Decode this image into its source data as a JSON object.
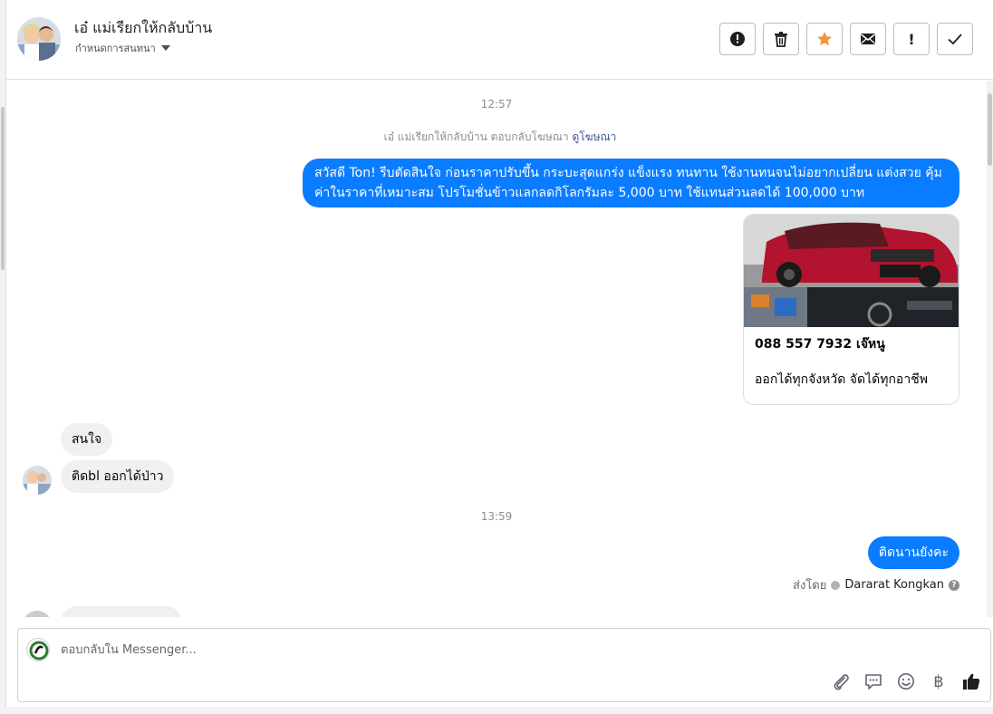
{
  "header": {
    "title": "เอ๋ แม่เรียกให้กลับบ้าน",
    "assign_label": "กำหนดการสนทนา"
  },
  "toolbar": {
    "buttons": [
      {
        "icon": "alert-circle-icon"
      },
      {
        "icon": "trash-icon"
      },
      {
        "icon": "star-icon",
        "color": "#f7923a"
      },
      {
        "icon": "envelope-icon"
      },
      {
        "icon": "exclamation-icon",
        "glyph": "!"
      },
      {
        "icon": "check-icon"
      }
    ]
  },
  "conversation": {
    "timestamp_1": "12:57",
    "reply_note": "เอ๋ แม่เรียกให้กลับบ้าน ตอบกลับโฆษณา",
    "reply_link": "ดูโฆษณา",
    "outgoing_1": "สวัสดี Ton! รีบตัดสินใจ ก่อนราคาปรับขึ้น กระบะสุดแกร่ง แข็งแรง ทนทาน ใช้งานทนจนไม่อยากเปลี่ยน แต่งสวย คุ้มค่าในราคาที่เหมาะสม โปรโมชั่นข้าวแลกลดกิโลกรัมละ 5,000 บาท ใช้แทนส่วนลดได้ 100,000 บาท",
    "card": {
      "title": "088 557 7932 เจ๊หนู",
      "description": "ออกได้ทุกจังหวัด จัดได้ทุกอาชีพ"
    },
    "incoming_1": "สนใจ",
    "incoming_2": "ติดbl ออกได้ป่าว",
    "timestamp_2": "13:59",
    "outgoing_2": "ติดนานยังคะ",
    "sent_by_label": "ส่งโดย",
    "sent_by_name": "Dararat Kongkan"
  },
  "composer": {
    "placeholder": "ตอบกลับใน Messenger...",
    "currency_glyph": "฿",
    "tools": [
      "paperclip-icon",
      "chat-bubble-icon",
      "smile-icon",
      "baht-icon",
      "thumbs-up-icon"
    ]
  },
  "colors": {
    "accent": "#0a7cff",
    "star": "#f7923a",
    "like": "#1c1e21"
  }
}
